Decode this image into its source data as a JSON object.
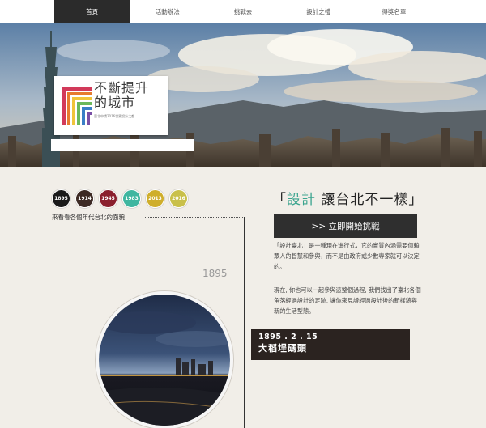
{
  "nav": {
    "items": [
      "首頁",
      "活動辦法",
      "挑戰去",
      "設計之禮",
      "得獎名單"
    ],
    "active_index": 0
  },
  "logo": {
    "title_line1": "不斷提升",
    "title_line2": "的城市",
    "subtitle": "臺北申請2016世界設計之都"
  },
  "decades": [
    {
      "label": "1895",
      "color": "#1a1a1a"
    },
    {
      "label": "1914",
      "color": "#3d2a24"
    },
    {
      "label": "1945",
      "color": "#8a1f2d"
    },
    {
      "label": "1983",
      "color": "#3fb6a0"
    },
    {
      "label": "2013",
      "color": "#cfae2b"
    },
    {
      "label": "2016",
      "color": "#c9c04a"
    }
  ],
  "decade_note": "來看看各個年代台北的面貌",
  "current_year": "1895",
  "headline": {
    "open": "「",
    "highlight": "設計",
    "rest": "讓台北不一樣",
    "close": "」",
    "highlight_color": "#3aa48e"
  },
  "cta_label": ">> 立即開始挑戰",
  "description": [
    "「設計臺北」是一種現在進行式，它的實質內涵需要仰賴眾人的智慧和參與，而不是由政府或少數專家就可以決定的。",
    "現在, 你也可以一起參與這整個過程, 我們找出了臺北各個角落經過設計的足跡, 讓你來見證經過設計後的新樣貌與新的生活型態。"
  ],
  "caption": {
    "date": "1895 . 2 . 15",
    "place": "大稻埕碼頭"
  }
}
